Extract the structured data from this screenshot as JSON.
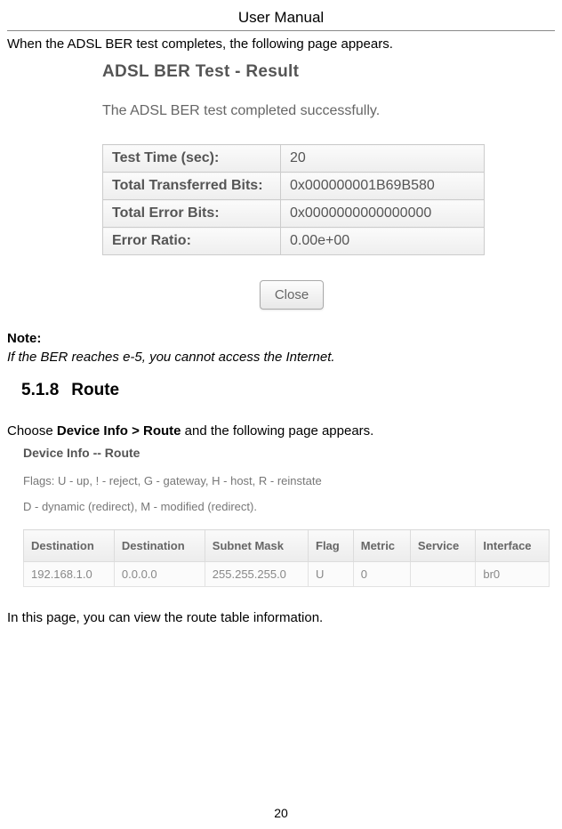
{
  "header": {
    "title": "User Manual"
  },
  "intro": "When the ADSL BER test completes, the following page appears.",
  "ber": {
    "title": "ADSL BER Test - Result",
    "success": "The ADSL BER test completed successfully.",
    "rows": [
      {
        "label": "Test Time (sec):",
        "value": "20"
      },
      {
        "label": "Total Transferred Bits:",
        "value": "0x000000001B69B580"
      },
      {
        "label": "Total Error Bits:",
        "value": "0x0000000000000000"
      },
      {
        "label": "Error Ratio:",
        "value": "0.00e+00"
      }
    ],
    "close": "Close"
  },
  "note": {
    "label": "Note:",
    "text": "If the BER reaches e-5, you cannot access the Internet."
  },
  "section": {
    "number": "5.1.8",
    "title": "Route"
  },
  "choose": {
    "pre": "Choose ",
    "bold": "Device Info > Route",
    "post": " and the following page appears."
  },
  "route": {
    "title": "Device Info -- Route",
    "flags1": "Flags: U - up, ! - reject, G - gateway, H - host, R - reinstate",
    "flags2": "D - dynamic (redirect), M - modified (redirect).",
    "headers": [
      "Destination",
      "Destination",
      "Subnet Mask",
      "Flag",
      "Metric",
      "Service",
      "Interface"
    ],
    "row": [
      "192.168.1.0",
      "0.0.0.0",
      "255.255.255.0",
      "U",
      "0",
      "",
      "br0"
    ]
  },
  "view": "In this page, you can view the route table information.",
  "pagenum": "20"
}
